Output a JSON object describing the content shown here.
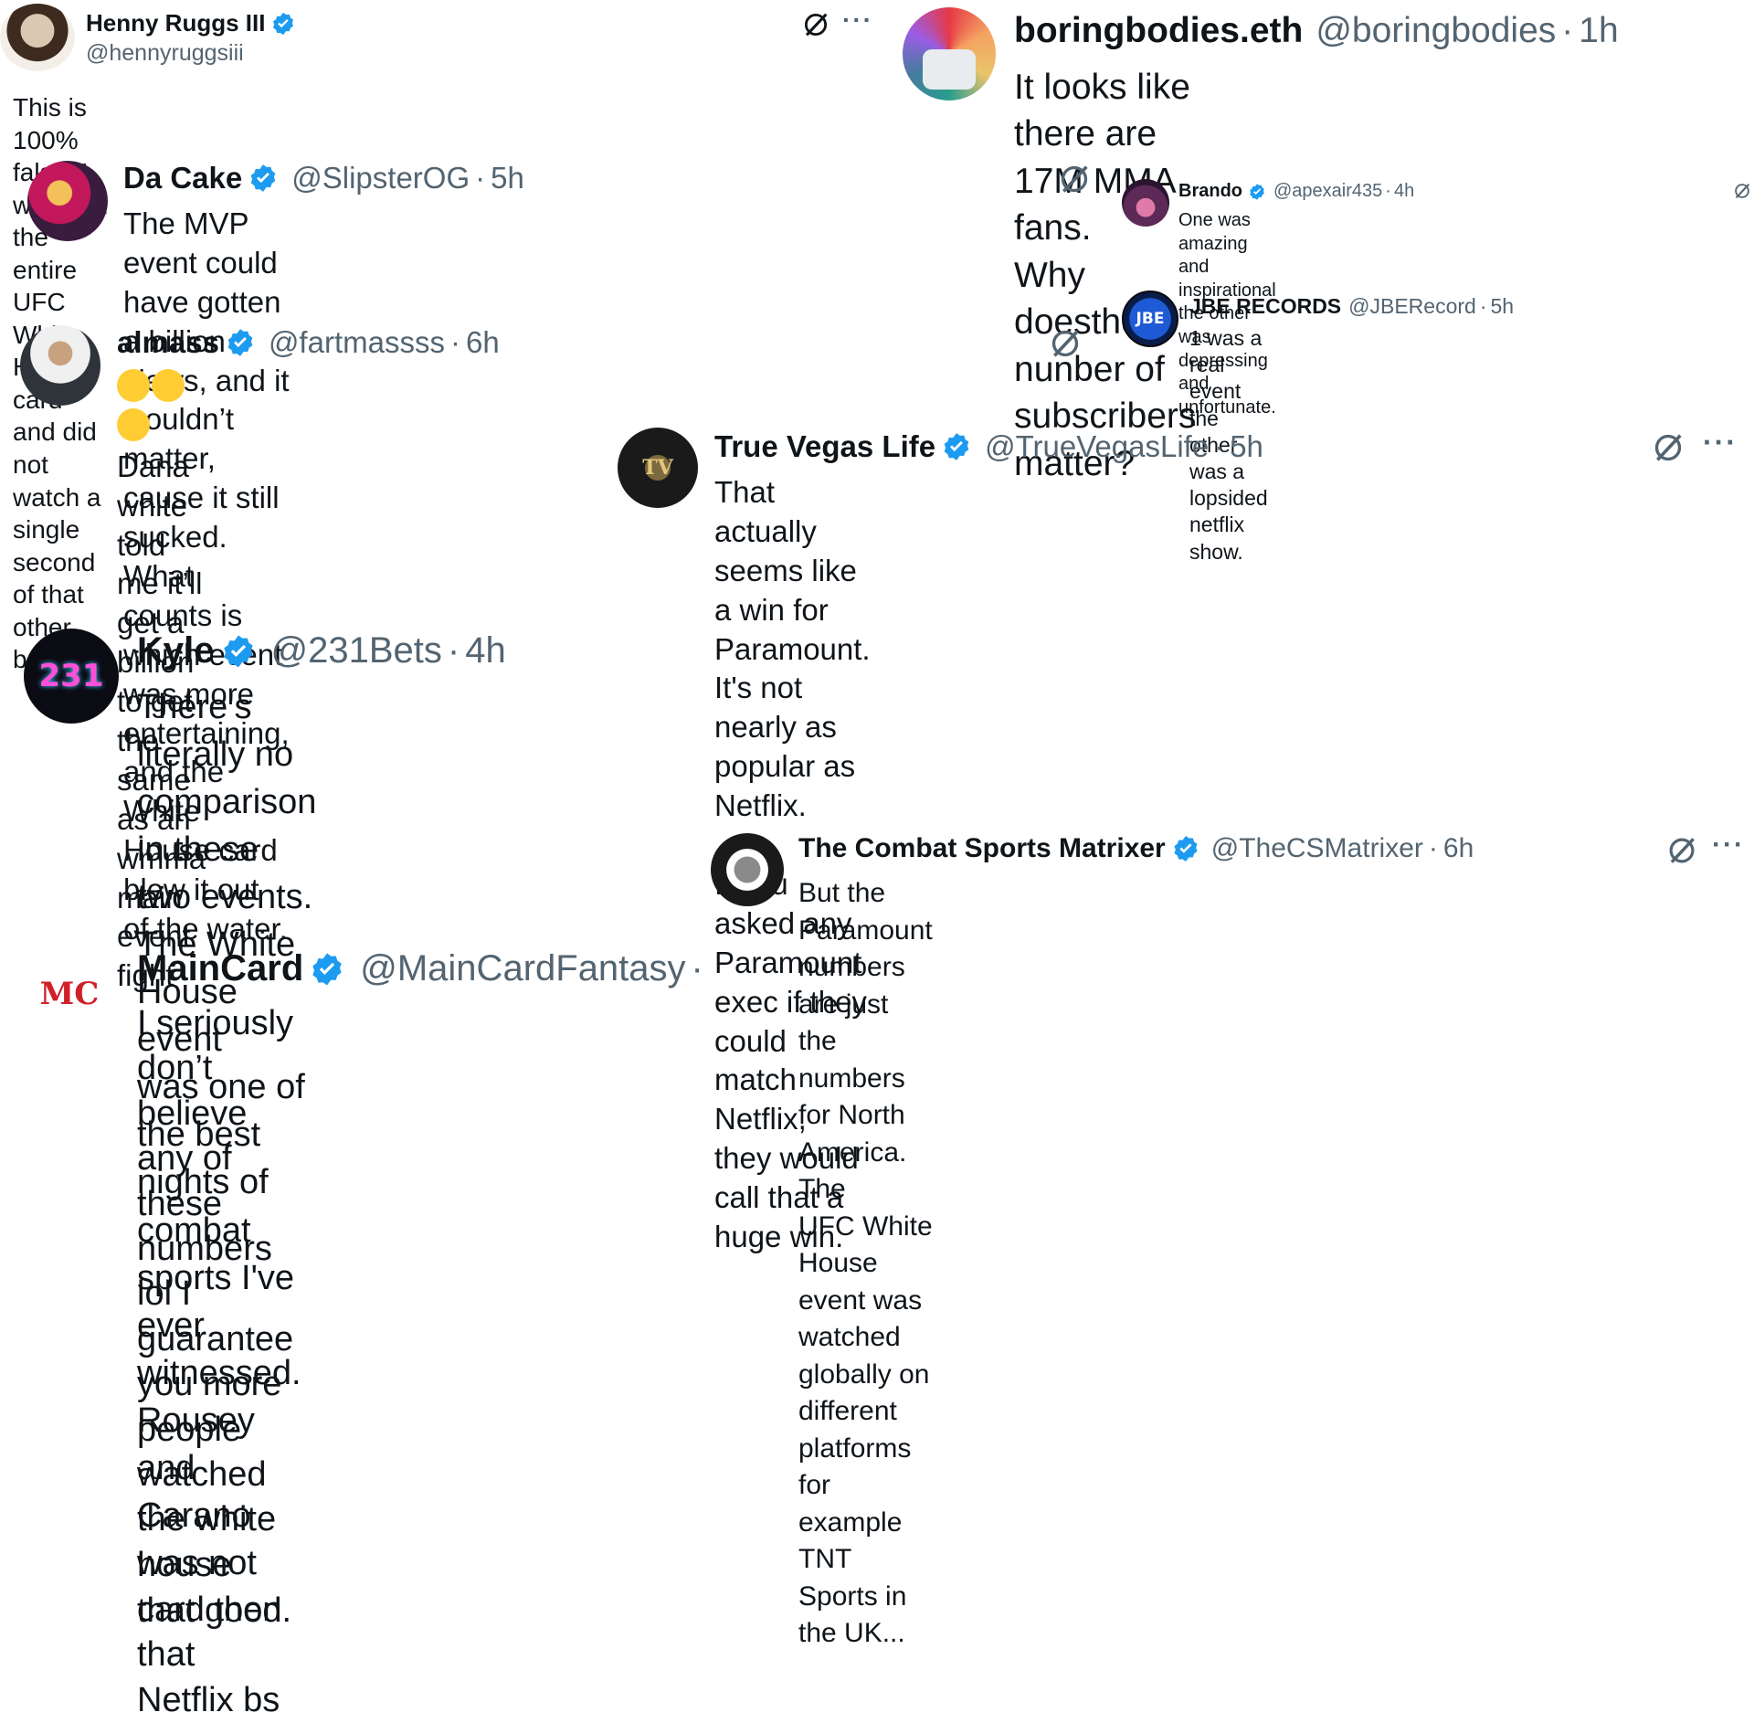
{
  "tweets": [
    {
      "id": "henny",
      "name": "Henny Ruggs III",
      "handle": "@hennyruggsiii",
      "time": "",
      "verified": true,
      "text_lines": [
        "This is 100% false. I watched the entire UFC White House card and did"
      ],
      "text_tail_pre": "not watch a single second of that other bulls",
      "text_tail_post": "t.",
      "avatar_color": "#6d5a4a"
    },
    {
      "id": "boring",
      "name": "boringbodies.eth",
      "handle": "@boringbodies",
      "time": "1h",
      "verified": false,
      "text_lines": [
        "It looks like there are 17M MMA fans.",
        "Why doesthe nunber of subscribers matter?"
      ],
      "avatar_color": "#2c3e78"
    },
    {
      "id": "dacake",
      "name": "Da Cake",
      "handle": "@SlipsterOG",
      "time": "5h",
      "verified": true,
      "text_lines": [
        "The MVP event could have gotten a billion views, and it wouldn’t matter,",
        "cause it still sucked. What counts is which event was more entertaining,",
        "and the White House card blew it out of the water."
      ],
      "avatar_color": "#8a2c3a"
    },
    {
      "id": "brando",
      "name": "Brando",
      "handle": "@apexair435",
      "time": "4h",
      "verified": true,
      "text_lines": [
        "One was amazing and inspirational the other was depressing and",
        "unfortunate."
      ],
      "avatar_color": "#6a3a5e"
    },
    {
      "id": "jbe",
      "name": "JBE RECORDS",
      "handle": "@JBERecord",
      "time": "5h",
      "verified": false,
      "text_lines": [
        "1 was a real event the other was a lopsided netflix show."
      ],
      "avatar_text": "JBE",
      "avatar_color": "#0d2a66"
    },
    {
      "id": "almass",
      "name": "almass",
      "handle": "@fartmassss",
      "time": "6h",
      "verified": true,
      "text_lines": [
        "Dana white told me it’ll get a billion to get the same as an wmma",
        "main event fight"
      ],
      "avatar_color": "#3b3f45"
    },
    {
      "id": "vegas",
      "name": "True Vegas Life",
      "handle": "@TrueVegasLife",
      "time": "5h",
      "verified": true,
      "text_lines": [
        "That actually seems like a win for Paramount. It's not nearly as popular as",
        "Netflix.",
        "",
        "If you asked any Paramount exec if they could match Netflix, they would",
        "call that a huge win."
      ],
      "avatar_text": "TV",
      "avatar_color": "#111111"
    },
    {
      "id": "kyle",
      "name": "Kyle",
      "handle": "@231Bets",
      "time": "4h",
      "verified": true,
      "text_lines": [
        "There's literally no comparison in these two events.  The White House event",
        "was one of the best nights of combat sports I've ever witnessed. Rousey",
        "and Carano was not that good."
      ],
      "avatar_text": "231",
      "avatar_color": "#0b0b14"
    },
    {
      "id": "matrixer",
      "name": "The Combat Sports Matrixer",
      "handle": "@TheCSMatrixer",
      "time": "6h",
      "verified": true,
      "text_lines": [
        "But the Paramount numbers are just the numbers for North America. The",
        "UFC White House event was watched globally on different platforms for",
        "example TNT Sports in the UK..."
      ],
      "avatar_color": "#1a1a1a"
    },
    {
      "id": "maincard",
      "name": "MainCard",
      "handle": "@MainCardFantasy",
      "time": "",
      "verified": true,
      "text_lines": [
        "I seriously don’t believe any of these numbers lol I guarantee you more",
        "people watched the white house card then that Netflix bs"
      ],
      "avatar_text": "MC",
      "avatar_color": "#ffffff"
    }
  ],
  "colors": {
    "verified": "#1d9bf0",
    "muted": "#536471",
    "text": "#0f1419"
  },
  "icons": {
    "grok": "grok-slash-icon",
    "more": "more-dots-icon",
    "verified": "verified-badge-icon"
  },
  "more_label": "···",
  "dot_sep": "·"
}
